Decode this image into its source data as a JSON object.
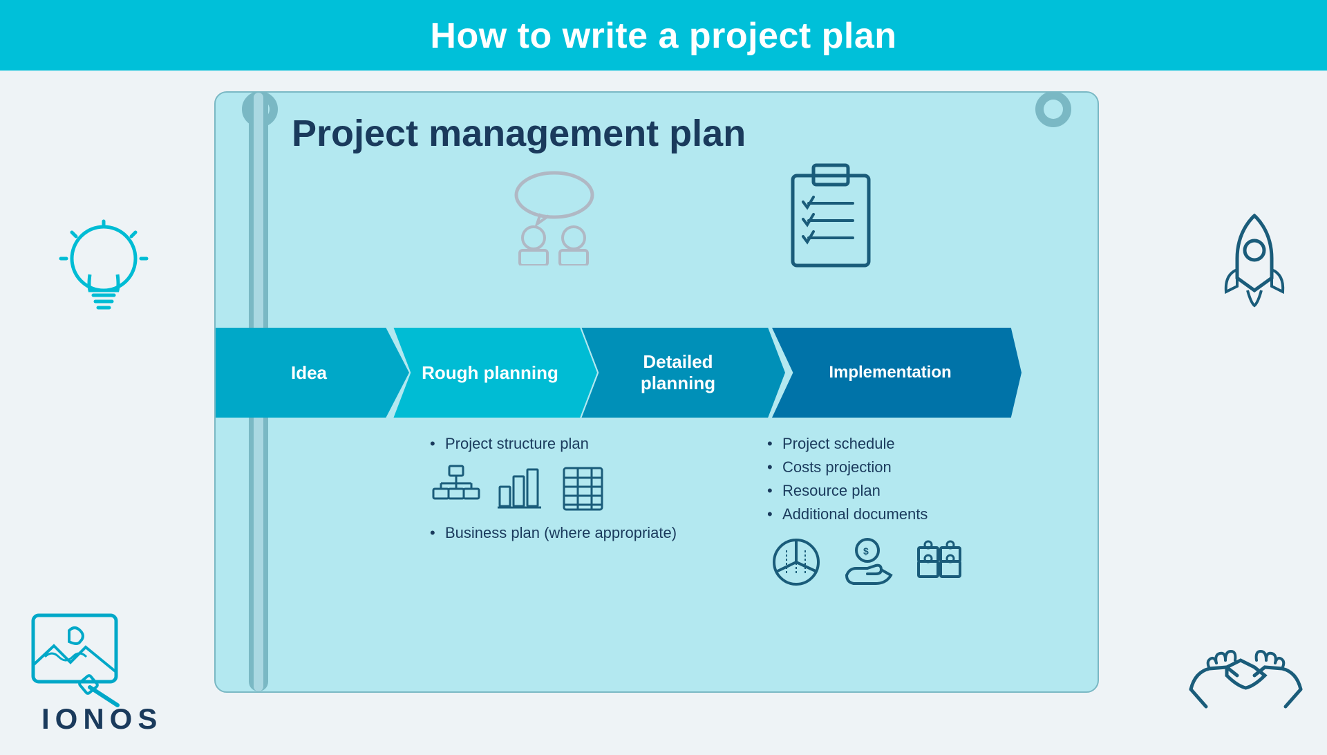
{
  "header": {
    "title": "How to write a project plan"
  },
  "scroll": {
    "title": "Project management plan"
  },
  "arrows": [
    {
      "id": "idea",
      "label": "Idea"
    },
    {
      "id": "rough-planning",
      "label": "Rough planning"
    },
    {
      "id": "detailed-planning",
      "label": "Detailed\nplanning"
    },
    {
      "id": "implementation",
      "label": "Implementation"
    }
  ],
  "rough_planning": {
    "items": [
      "Project structure plan",
      "Business plan (where appropriate)"
    ]
  },
  "detailed_planning": {
    "items": [
      "Project schedule",
      "Costs projection",
      "Resource plan",
      "Additional documents"
    ]
  },
  "brand": {
    "name": "IONOS"
  },
  "colors": {
    "header_bg": "#00c0d9",
    "scroll_bg": "#b3e8f0",
    "arrow_idea": "#00a8c8",
    "arrow_rough": "#00bcd4",
    "arrow_detailed": "#0090b8",
    "arrow_implementation": "#0073a8",
    "text_dark": "#1a3a5c",
    "icon_color": "#7ab8c4",
    "icon_dark": "#1a5c7a"
  }
}
